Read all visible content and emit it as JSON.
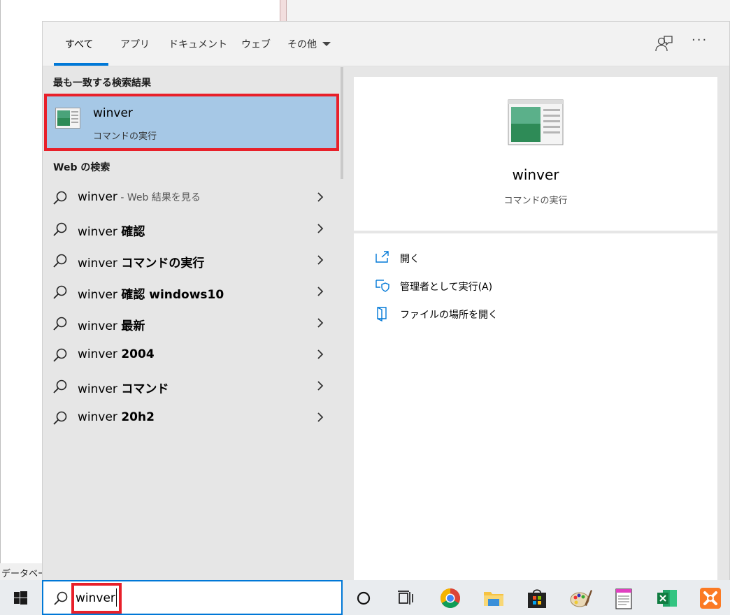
{
  "background": {
    "status_text": "データベー"
  },
  "tabs": [
    {
      "label": "すべて"
    },
    {
      "label": "アプリ"
    },
    {
      "label": "ドキュメント"
    },
    {
      "label": "ウェブ"
    },
    {
      "label": "その他"
    }
  ],
  "sections": {
    "best_match": "最も一致する検索結果",
    "web": "Web の検索"
  },
  "best_match": {
    "title": "winver",
    "subtitle": "コマンドの実行"
  },
  "web_results": [
    {
      "query": "winver",
      "hint": " - Web 結果を見る",
      "suffix": ""
    },
    {
      "query": "winver ",
      "hint": "",
      "suffix": "確認"
    },
    {
      "query": "winver ",
      "hint": "",
      "suffix": "コマンドの実行"
    },
    {
      "query": "winver ",
      "hint": "",
      "suffix": "確認 windows10"
    },
    {
      "query": "winver ",
      "hint": "",
      "suffix": "最新"
    },
    {
      "query": "winver ",
      "hint": "",
      "suffix": "2004"
    },
    {
      "query": "winver ",
      "hint": "",
      "suffix": "コマンド"
    },
    {
      "query": "winver ",
      "hint": "",
      "suffix": "20h2"
    }
  ],
  "preview": {
    "title": "winver",
    "subtitle": "コマンドの実行"
  },
  "actions": [
    {
      "label": "開く",
      "icon": "open-icon"
    },
    {
      "label": "管理者として実行(A)",
      "icon": "shield-icon"
    },
    {
      "label": "ファイルの場所を開く",
      "icon": "file-location-icon"
    }
  ],
  "search": {
    "value": "winver"
  },
  "colors": {
    "accent": "#0078d7",
    "highlight": "#a6c8e6",
    "annotation_red": "#e8202a"
  }
}
